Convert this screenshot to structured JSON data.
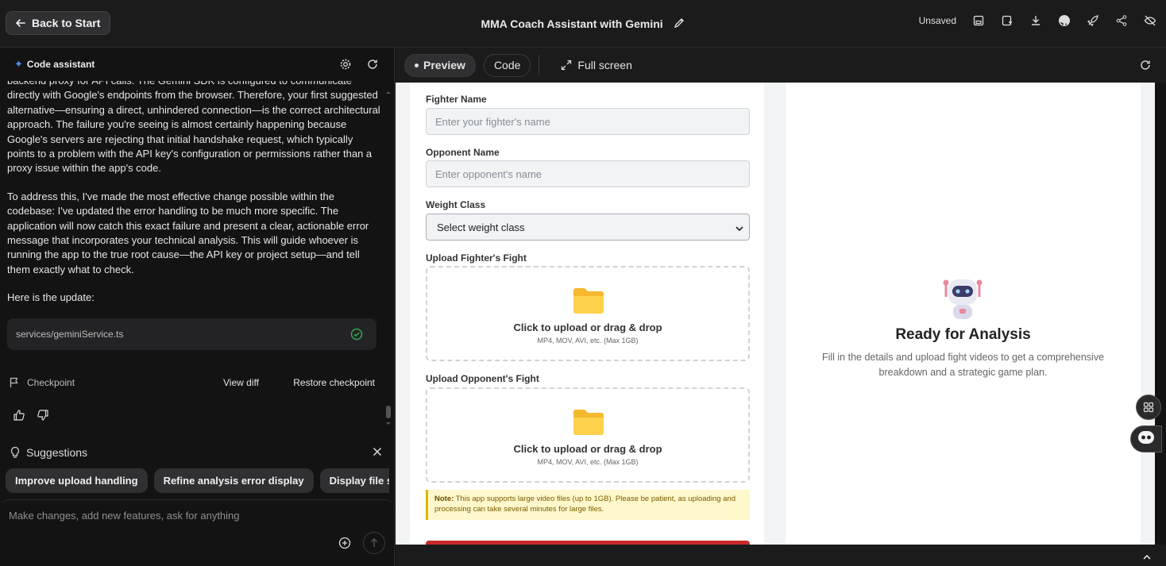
{
  "topbar": {
    "back_label": "Back to Start",
    "title": "MMA Coach Assistant with Gemini",
    "status": "Unsaved"
  },
  "assistant": {
    "header": "Code assistant",
    "messages": [
      "backend proxy for API calls. The Gemini SDK is configured to communicate directly with Google's endpoints from the browser. Therefore, your first suggested alternative—ensuring a direct, unhindered connection—is the correct architectural approach. The failure you're seeing is almost certainly happening because Google's servers are rejecting that initial handshake request, which typically points to a problem with the API key's configuration or permissions rather than a proxy issue within the app's code.",
      "To address this, I've made the most effective change possible within the codebase: I've updated the error handling to be much more specific. The application will now catch this exact failure and present a clear, actionable error message that incorporates your technical analysis. This will guide whoever is running the app to the true root cause—the API key or project setup—and tell them exactly what to check.",
      "Here is the update:"
    ],
    "file": "services/geminiService.ts",
    "checkpoint_label": "Checkpoint",
    "view_diff": "View diff",
    "restore": "Restore checkpoint",
    "suggestions_label": "Suggestions",
    "suggestions": [
      "Improve upload handling",
      "Refine analysis error display",
      "Display file si"
    ],
    "input_placeholder": "Make changes, add new features, ask for anything"
  },
  "toolbar": {
    "preview_tab": "Preview",
    "code_tab": "Code",
    "fullscreen": "Full screen"
  },
  "form": {
    "fighter_label": "Fighter Name",
    "fighter_placeholder": "Enter your fighter's name",
    "opponent_label": "Opponent Name",
    "opponent_placeholder": "Enter opponent's name",
    "weight_label": "Weight Class",
    "weight_selected": "Select weight class",
    "upload_fighter_label": "Upload Fighter's Fight",
    "upload_opponent_label": "Upload Opponent's Fight",
    "dropzone_main": "Click to upload or drag & drop",
    "dropzone_sub": "MP4, MOV, AVI, etc. (Max 1GB)",
    "note_label": "Note:",
    "note_text": "This app supports large video files (up to 1GB). Please be patient, as uploading and processing can take several minutes for large files."
  },
  "results": {
    "title": "Ready for Analysis",
    "subtitle": "Fill in the details and upload fight videos to get a comprehensive breakdown and a strategic game plan."
  },
  "colors": {
    "accent_blue": "#4d8df5",
    "success_green": "#34a853",
    "submit_red": "#c92a2a",
    "note_bg": "#fff8cc"
  }
}
